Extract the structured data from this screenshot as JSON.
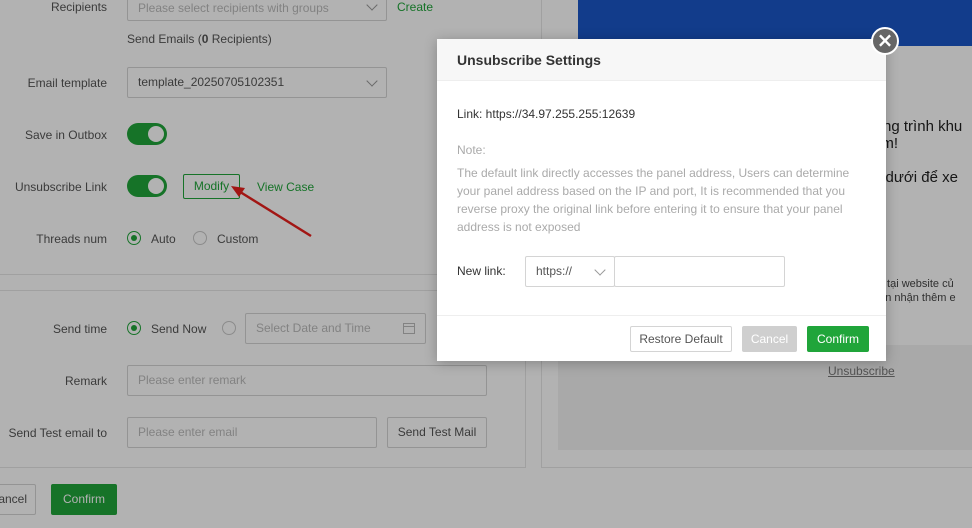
{
  "form": {
    "recipients_label": "Recipients",
    "recipients_placeholder": "Please select recipients with groups",
    "create_link": "Create",
    "send_emails_prefix": "Send Emails (",
    "send_emails_count": "0",
    "send_emails_suffix": " Recipients)",
    "template_label": "Email template",
    "template_value": "template_20250705102351",
    "outbox_label": "Save in Outbox",
    "unsubscribe_label": "Unsubscribe Link",
    "modify_button": "Modify",
    "view_case_link": "View Case",
    "threads_label": "Threads num",
    "threads_auto": "Auto",
    "threads_custom": "Custom",
    "send_time_label": "Send time",
    "send_now": "Send Now",
    "date_placeholder": "Select Date and Time",
    "remark_label": "Remark",
    "remark_placeholder": "Please enter remark",
    "test_email_label": "Send Test email to",
    "test_email_placeholder": "Please enter email",
    "send_test_button": "Send Test Mail",
    "cancel_button": "ancel",
    "confirm_button": "Confirm"
  },
  "preview": {
    "line1": "ưng trình khu",
    "line2": "ẩm!",
    "line3": "n dưới để xe",
    "footer1": "ký tại website củ",
    "footer2": "uốn nhận thêm e",
    "unsubscribe": "Unsubscribe"
  },
  "modal": {
    "title": "Unsubscribe Settings",
    "link_text": "Link: https://34.97.255.255:12639",
    "note_label": "Note:",
    "note_body": "The default link directly accesses the panel address, Users can determine your panel address based on the IP and port, It is recommended that you reverse proxy the original link before entering it to ensure that your panel address is not exposed",
    "new_link_label": "New link:",
    "protocol_value": "https://",
    "restore_button": "Restore Default",
    "cancel_button": "Cancel",
    "confirm_button": "Confirm"
  },
  "colors": {
    "accent": "#20a53a",
    "preview_banner": "#1a56c8",
    "arrow": "#e8201e"
  }
}
